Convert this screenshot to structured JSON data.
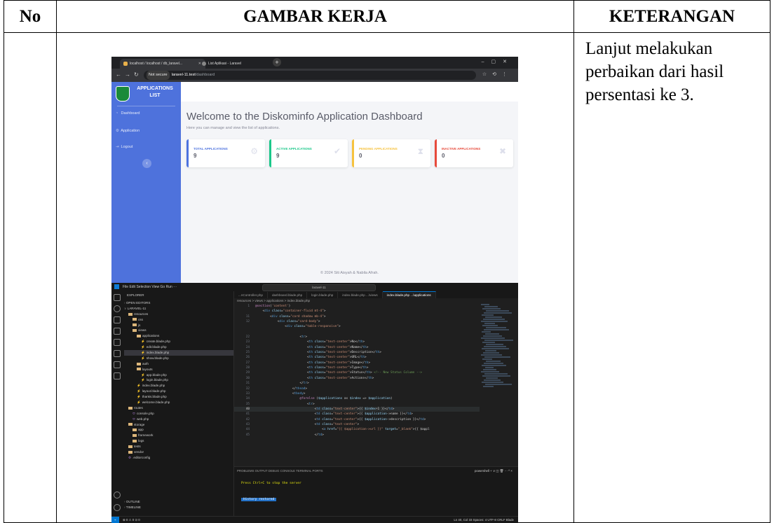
{
  "table": {
    "col_no": "No",
    "col_gambar": "GAMBAR KERJA",
    "col_keterangan": "KETERANGAN",
    "keterangan_text": "Lanjut melakukan perbaikan dari hasil persentasi ke 3."
  },
  "browser": {
    "tab1_title": "localhost / localhost / db_laravel...",
    "tab2_title": "List Aplikasi - Laravel",
    "new_tab": "+",
    "not_secure": "Not secure",
    "url_host": "laravel-11.test",
    "url_path": "/dashboard"
  },
  "app": {
    "brand_line1": "APPLICATIONS",
    "brand_line2": "LIST",
    "nav_dashboard": "Dashboard",
    "nav_application": "Application",
    "nav_logout": "Logout",
    "toggle": "‹",
    "welcome": "Welcome to the Diskominfo Application Dashboard",
    "subtext": "Here you can manage and view the list of applications.",
    "cards": [
      {
        "label": "TOTAL APPLICATIONS",
        "value": "9",
        "color": "#4e73df",
        "icon": "gears-icon"
      },
      {
        "label": "ACTIVE APPLICATIONS",
        "value": "9",
        "color": "#1cc88a",
        "icon": "check-circle-icon"
      },
      {
        "label": "PENDING APPLICATIONS",
        "value": "0",
        "color": "#f6c23e",
        "icon": "hourglass-icon"
      },
      {
        "label": "INACTIVE APPLICATIONS",
        "value": "0",
        "color": "#e74a3b",
        "icon": "times-circle-icon"
      }
    ],
    "footer": "© 2024 Siti Aisyah & Nabila Afrah."
  },
  "vscode": {
    "menu": "File   Edit   Selection   View   Go   Run   ···",
    "search": "laravel-11",
    "explorer_title": "EXPLORER",
    "open_editors": "OPEN EDITORS",
    "project": "LARAVEL-11",
    "tree": [
      {
        "label": "resources",
        "kind": "folder",
        "indent": 1
      },
      {
        "label": "css",
        "kind": "folder",
        "indent": 2
      },
      {
        "label": "js",
        "kind": "folder",
        "indent": 2
      },
      {
        "label": "views",
        "kind": "folder",
        "indent": 2
      },
      {
        "label": "applications",
        "kind": "folder",
        "indent": 3
      },
      {
        "label": "create.blade.php",
        "kind": "blade",
        "indent": 4
      },
      {
        "label": "edit.blade.php",
        "kind": "blade",
        "indent": 4
      },
      {
        "label": "index.blade.php",
        "kind": "blade",
        "indent": 4,
        "selected": true
      },
      {
        "label": "show.blade.php",
        "kind": "blade",
        "indent": 4
      },
      {
        "label": "auth",
        "kind": "folder",
        "indent": 3
      },
      {
        "label": "layouts",
        "kind": "folder",
        "indent": 3
      },
      {
        "label": "app.blade.php",
        "kind": "blade",
        "indent": 4
      },
      {
        "label": "login.blade.php",
        "kind": "blade",
        "indent": 4
      },
      {
        "label": "index.blade.php",
        "kind": "blade",
        "indent": 3
      },
      {
        "label": "layout.blade.php",
        "kind": "blade",
        "indent": 3
      },
      {
        "label": "thanks.blade.php",
        "kind": "blade",
        "indent": 3
      },
      {
        "label": "welcome.blade.php",
        "kind": "blade",
        "indent": 3
      },
      {
        "label": "routes",
        "kind": "folder",
        "indent": 1
      },
      {
        "label": "console.php",
        "kind": "php",
        "indent": 2
      },
      {
        "label": "web.php",
        "kind": "php",
        "indent": 2
      },
      {
        "label": "storage",
        "kind": "folder",
        "indent": 1
      },
      {
        "label": "app",
        "kind": "folder",
        "indent": 2
      },
      {
        "label": "framework",
        "kind": "folder",
        "indent": 2
      },
      {
        "label": "logs",
        "kind": "folder",
        "indent": 2
      },
      {
        "label": "tests",
        "kind": "folder",
        "indent": 1
      },
      {
        "label": "vendor",
        "kind": "folder",
        "indent": 1
      },
      {
        "label": ".editorconfig",
        "kind": "file",
        "indent": 1
      }
    ],
    "outline": "OUTLINE",
    "timeline": "TIMELINE",
    "tabs": [
      "...nController.php",
      "dashboard.blade.php",
      "login.blade.php",
      "index.blade.php ...\\views",
      "index.blade.php ...\\applications"
    ],
    "breadcrumb": "resources > views > applications > index.blade.php",
    "code_lines": [
      {
        "n": "1",
        "html": "<span class='dir'>@section</span>(<span class='st'>'content'</span>)"
      },
      {
        "n": "",
        "html": "    &lt;<span class='tg'>div</span> <span class='at'>class</span>=<span class='st'>\"container-fluid mt-4\"</span>&gt;"
      },
      {
        "n": "11",
        "html": "        &lt;<span class='tg'>div</span> <span class='at'>class</span>=<span class='st'>\"card shadow mb-4\"</span>&gt;"
      },
      {
        "n": "12",
        "html": "            &lt;<span class='tg'>div</span> <span class='at'>class</span>=<span class='st'>\"card-body\"</span>&gt;"
      },
      {
        "n": "",
        "html": "                &lt;<span class='tg'>div</span> <span class='at'>class</span>=<span class='st'>\"table-responsive\"</span>&gt;"
      },
      {
        "n": "",
        "html": ""
      },
      {
        "n": "22",
        "html": "                        &lt;<span class='tg'>tr</span>&gt;"
      },
      {
        "n": "23",
        "html": "                            &lt;<span class='tg'>th</span> <span class='at'>class</span>=<span class='st'>\"text-center\"</span>&gt;No&lt;/<span class='tg'>th</span>&gt;"
      },
      {
        "n": "24",
        "html": "                            &lt;<span class='tg'>th</span> <span class='at'>class</span>=<span class='st'>\"text-center\"</span>&gt;Name&lt;/<span class='tg'>th</span>&gt;"
      },
      {
        "n": "25",
        "html": "                            &lt;<span class='tg'>th</span> <span class='at'>class</span>=<span class='st'>\"text-center\"</span>&gt;Description&lt;/<span class='tg'>th</span>&gt;"
      },
      {
        "n": "26",
        "html": "                            &lt;<span class='tg'>th</span> <span class='at'>class</span>=<span class='st'>\"text-center\"</span>&gt;URL&lt;/<span class='tg'>th</span>&gt;"
      },
      {
        "n": "27",
        "html": "                            &lt;<span class='tg'>th</span> <span class='at'>class</span>=<span class='st'>\"text-center\"</span>&gt;Image&lt;/<span class='tg'>th</span>&gt;"
      },
      {
        "n": "28",
        "html": "                            &lt;<span class='tg'>th</span> <span class='at'>class</span>=<span class='st'>\"text-center\"</span>&gt;Type&lt;/<span class='tg'>th</span>&gt;"
      },
      {
        "n": "29",
        "html": "                            &lt;<span class='tg'>th</span> <span class='at'>class</span>=<span class='st'>\"text-center\"</span>&gt;Status&lt;/<span class='tg'>th</span>&gt; <span class='cm'>&lt;!-- New Status Column --&gt;</span>"
      },
      {
        "n": "30",
        "html": "                            &lt;<span class='tg'>th</span> <span class='at'>class</span>=<span class='st'>\"text-center\"</span>&gt;Actions&lt;/<span class='tg'>th</span>&gt;"
      },
      {
        "n": "31",
        "html": "                        &lt;/<span class='tg'>tr</span>&gt;"
      },
      {
        "n": "32",
        "html": "                    &lt;/<span class='tg'>thead</span>&gt;"
      },
      {
        "n": "33",
        "html": "                    &lt;<span class='tg'>tbody</span>&gt;"
      },
      {
        "n": "34",
        "html": "                        <span class='dir'>@forelse</span> (<span class='vr'>$applications</span> as <span class='vr'>$index</span> =&gt; <span class='vr'>$application</span>)"
      },
      {
        "n": "35",
        "html": "                            &lt;<span class='tg'>tr</span>&gt;"
      },
      {
        "n": "40",
        "html": "                                &lt;<span class='tg'>td</span> <span class='at'>class</span>=<span class='st'>\"text-center\"</span>&gt;{{ <span class='vr'>$index</span>+1 }}&lt;/<span class='tg'>td</span>&gt;",
        "hl": true
      },
      {
        "n": "41",
        "html": "                                &lt;<span class='tg'>td</span> <span class='at'>class</span>=<span class='st'>\"text-center\"</span>&gt;{{ <span class='vr'>$application</span>-&gt;name }}&lt;/<span class='tg'>td</span>&gt;"
      },
      {
        "n": "42",
        "html": "                                &lt;<span class='tg'>td</span> <span class='at'>class</span>=<span class='st'>\"text-center\"</span>&gt;{{ <span class='vr'>$application</span>-&gt;description }}&lt;/<span class='tg'>td</span>&gt;"
      },
      {
        "n": "43",
        "html": "                                &lt;<span class='tg'>td</span> <span class='at'>class</span>=<span class='st'>\"text-center\"</span>&gt;"
      },
      {
        "n": "44",
        "html": "                                    &lt;<span class='tg'>a</span> <span class='at'>href</span>=<span class='st'>\"{{ $application-&gt;url }}\"</span> <span class='at'>target</span>=<span class='st'>\"_blank\"</span>&gt;{{ $appl"
      },
      {
        "n": "45",
        "html": "                                &lt;/<span class='tg'>td</span>&gt;"
      }
    ],
    "terminal_tabs": "PROBLEMS    OUTPUT    DEBUG CONSOLE    TERMINAL    PORTS",
    "terminal_active": "TERMINAL",
    "terminal_right": "powershell  +  ∨  ◫  🗑  ···  ^  ×",
    "term_line1": "Press Ctrl+C to stop the server",
    "term_line2": "History restored",
    "status_left": "⊗ 0 ⚠ 0   ⊙ 0",
    "status_right": "Ln 40, Col 33   Spaces: 4   UTF-8   CRLF   Blade"
  }
}
